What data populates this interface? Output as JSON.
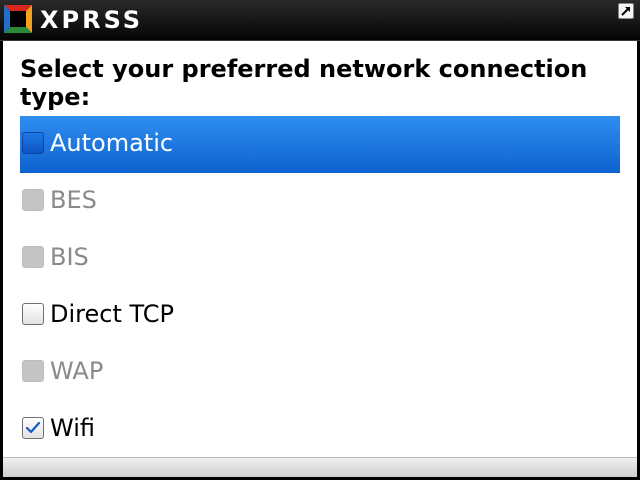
{
  "app": {
    "brand": "XPRSS",
    "logo_icon": "xprss-logo-icon",
    "corner_icon": "resize-arrow-icon"
  },
  "dialog": {
    "heading": "Select your preferred network connection type:",
    "options": [
      {
        "label": "Automatic",
        "checked": false,
        "enabled": true,
        "selected": true
      },
      {
        "label": "BES",
        "checked": false,
        "enabled": false,
        "selected": false
      },
      {
        "label": "BIS",
        "checked": false,
        "enabled": false,
        "selected": false
      },
      {
        "label": "Direct TCP",
        "checked": false,
        "enabled": true,
        "selected": false
      },
      {
        "label": "WAP",
        "checked": false,
        "enabled": false,
        "selected": false
      },
      {
        "label": "Wifi",
        "checked": true,
        "enabled": true,
        "selected": false
      }
    ]
  },
  "colors": {
    "selection": "#1a74e0",
    "disabled_text": "#8a8a8a",
    "title_bar": "#111111"
  }
}
